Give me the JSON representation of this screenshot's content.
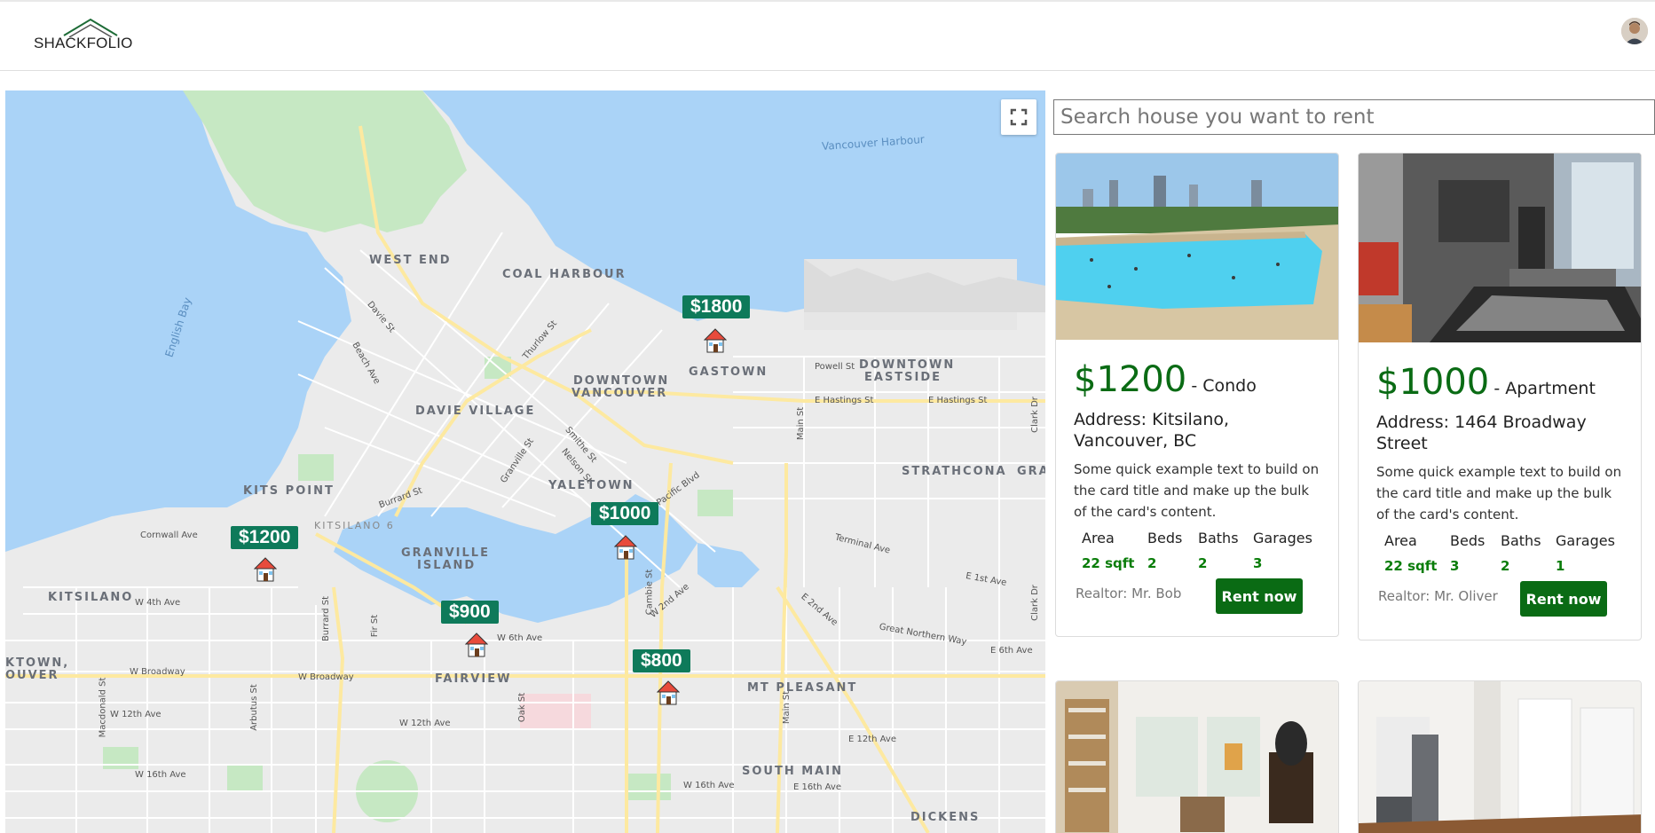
{
  "app": {
    "logo_text": "SHACKFOLIO"
  },
  "search": {
    "placeholder": "Search house you want to rent"
  },
  "map": {
    "pins": [
      {
        "price": "$1800"
      },
      {
        "price": "$1000"
      },
      {
        "price": "$1200"
      },
      {
        "price": "$900"
      },
      {
        "price": "$800"
      }
    ],
    "neighbourhoods": {
      "west_end": "WEST END",
      "coal_harbour": "COAL HARBOUR",
      "downtown_vancouver_1": "DOWNTOWN",
      "downtown_vancouver_2": "VANCOUVER",
      "gastown": "GASTOWN",
      "downtown_eastside_1": "DOWNTOWN",
      "downtown_eastside_2": "EASTSIDE",
      "davie_village": "DAVIE VILLAGE",
      "yaletown": "YALETOWN",
      "strathcona": "STRATHCONA",
      "kits_point": "KITS POINT",
      "granville_island_1": "GRANVILLE",
      "granville_island_2": "ISLAND",
      "kitsilano": "KITSILANO",
      "fairview": "FAIRVIEW",
      "mt_pleasant": "MT PLEASANT",
      "south_main": "SOUTH MAIN",
      "dickens": "DICKENS",
      "kitsilano_mark": "KITSILANO 6",
      "gra": "GRA",
      "ktown_1": "KTOWN,",
      "ktown_2": "OUVER"
    },
    "water": {
      "vancouver_harbour": "Vancouver Harbour",
      "english_bay": "English Bay"
    },
    "streets": {
      "e_hastings_1": "E Hastings St",
      "e_hastings_2": "E Hastings St",
      "powell": "Powell St",
      "w_broadway": "W Broadway",
      "w_broadway_2": "W Broadway",
      "w_4th": "W 4th Ave",
      "w_6th": "W 6th Ave",
      "w_12th": "W 12th Ave",
      "w_12th_2": "W 12th Ave",
      "w_16th": "W 16th Ave",
      "w_16th_2": "W 16th Ave",
      "e_12th": "E 12th Ave",
      "e_16th": "E 16th Ave",
      "e_1st": "E 1st Ave",
      "e_2nd": "E 2nd Ave",
      "e_6th": "E 6th Ave",
      "cornwall": "Cornwall Ave",
      "terminal": "Terminal Ave",
      "great_northern": "Great Northern Way",
      "pacific": "Pacific Blvd",
      "burrard": "Burrard St",
      "burrard_2": "Burrard St",
      "granville": "Granville St",
      "main": "Main St",
      "main_2": "Main St",
      "cambie": "Cambie St",
      "clark": "Clark Dr",
      "clark_2": "Clark Dr",
      "fir": "Fir St",
      "oak": "Oak St",
      "arbutus": "Arbutus St",
      "macdonald": "Macdonald St",
      "davie": "Davie St",
      "thurlow": "Thurlow St",
      "smithe": "Smithe St",
      "nelson": "Nelson St",
      "beach": "Beach Ave",
      "w2nd": "W 2nd Ave"
    }
  },
  "listings": [
    {
      "price": "$1200",
      "type": "- Condo",
      "address": "Address: Kitsilano, Vancouver, BC",
      "description": "Some quick example text to build on the card title and make up the bulk of the card's content.",
      "specs_headers": [
        "Area",
        "Beds",
        "Baths",
        "Garages"
      ],
      "specs_values": [
        "22 sqft",
        "2",
        "2",
        "3"
      ],
      "realtor": "Realtor: Mr. Bob",
      "button": "Rent now"
    },
    {
      "price": "$1000",
      "type": "- Apartment",
      "address": "Address: 1464 Broadway Street",
      "description": "Some quick example text to build on the card title and make up the bulk of the card's content.",
      "specs_headers": [
        "Area",
        "Beds",
        "Baths",
        "Garages"
      ],
      "specs_values": [
        "22 sqft",
        "3",
        "2",
        "1"
      ],
      "realtor": "Realtor: Mr. Oliver",
      "button": "Rent now"
    }
  ],
  "colors": {
    "brand_green": "#0a6b14",
    "pin_green": "#0e7a5a",
    "water": "#aad3f7",
    "park": "#c6e8c3"
  },
  "icons": {
    "fullscreen": "fullscreen-icon",
    "house": "house-icon"
  }
}
